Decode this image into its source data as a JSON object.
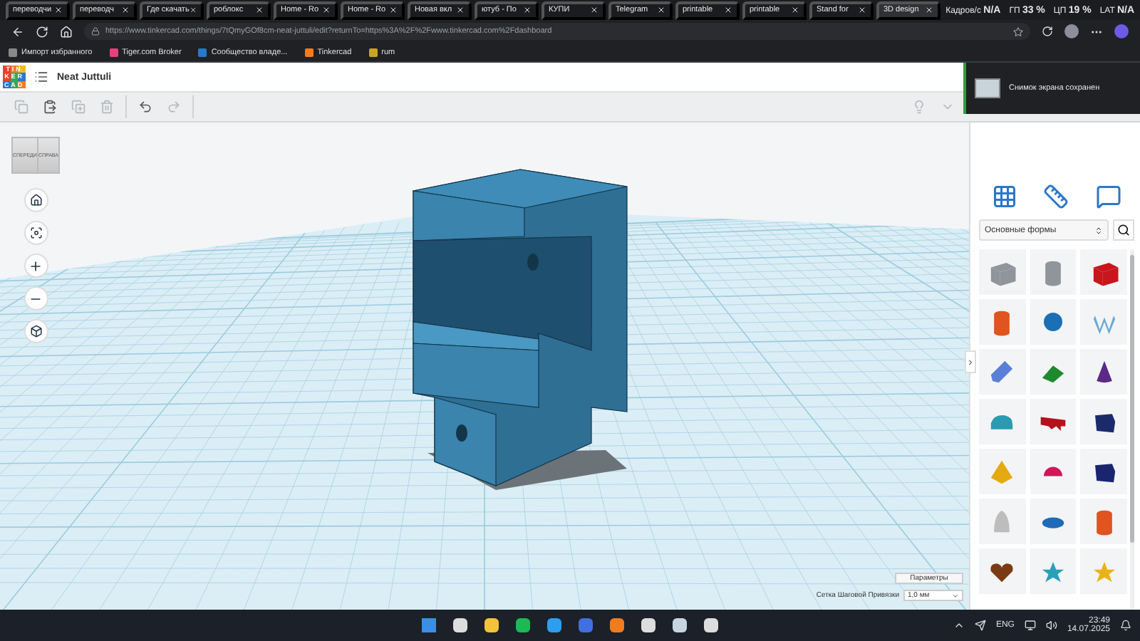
{
  "browser": {
    "tabs": [
      {
        "title": "переводчи",
        "selected": false
      },
      {
        "title": "переводч",
        "selected": false
      },
      {
        "title": "Где скачать",
        "selected": false
      },
      {
        "title": "роблокс",
        "selected": false
      },
      {
        "title": "Home - Ro",
        "selected": false
      },
      {
        "title": "Home - Ro",
        "selected": false
      },
      {
        "title": "Новая вкл",
        "selected": false
      },
      {
        "title": "ютуб - По",
        "selected": false
      },
      {
        "title": "КУПИ",
        "selected": false
      },
      {
        "title": "Telegram",
        "selected": false
      },
      {
        "title": "printable",
        "selected": false
      },
      {
        "title": "printable",
        "selected": false
      },
      {
        "title": "Stand for",
        "selected": false
      },
      {
        "title": "3D design",
        "selected": true
      }
    ],
    "url": "https://www.tinkercad.com/things/7tQmyGOf8cm-neat-juttuli/edit?returnTo=https%3A%2F%2Fwww.tinkercad.com%2Fdashboard",
    "bookmarks": [
      "Импорт избранного",
      "Tiger.com Broker",
      "Сообщество владе...",
      "Tinkercad",
      "rum"
    ]
  },
  "stats": [
    {
      "label": "Кадров/с",
      "value": "N/A"
    },
    {
      "label": "ГП",
      "value": "33 %"
    },
    {
      "label": "ЦП",
      "value": "19 %"
    },
    {
      "label": "LAT",
      "value": "N/A"
    }
  ],
  "app": {
    "logo": [
      "TIN",
      "KER",
      "CAD"
    ],
    "title": "Neat Juttuli"
  },
  "toast": "Снимок экрана сохранен",
  "viewcube": [
    "СПЕРЕДИ",
    "СПРАВА"
  ],
  "panel": {
    "category": "Основные формы",
    "shapes": [
      {
        "kind": "box_hole",
        "color": "#8f959b"
      },
      {
        "kind": "cylinder_hole",
        "color": "#8f959b"
      },
      {
        "kind": "box",
        "color": "#c8161d"
      },
      {
        "kind": "cylinder",
        "color": "#e0541f"
      },
      {
        "kind": "sphere",
        "color": "#1a6fb5"
      },
      {
        "kind": "scribble",
        "color": "#6aa8d8"
      },
      {
        "kind": "sketch",
        "color": "#5a7fd6"
      },
      {
        "kind": "roof",
        "color": "#1e8a2e"
      },
      {
        "kind": "cone",
        "color": "#5b2a86"
      },
      {
        "kind": "round_roof",
        "color": "#2a9bb0"
      },
      {
        "kind": "text",
        "color": "#b3121c"
      },
      {
        "kind": "wedge",
        "color": "#1b2a6b"
      },
      {
        "kind": "pyramid",
        "color": "#e5a912"
      },
      {
        "kind": "half_sphere",
        "color": "#d01656"
      },
      {
        "kind": "polygon",
        "color": "#1a2570"
      },
      {
        "kind": "paraboloid",
        "color": "#bdbdbd"
      },
      {
        "kind": "torus",
        "color": "#1f6bb8"
      },
      {
        "kind": "tube",
        "color": "#e0541f"
      },
      {
        "kind": "heart",
        "color": "#7a3b12"
      },
      {
        "kind": "star",
        "color": "#2aa0b8"
      },
      {
        "kind": "star",
        "color": "#e8b316"
      }
    ]
  },
  "footer": {
    "settings_button": "Параметры",
    "snap_label": "Сетка Шаговой Привязки",
    "snap_value": "1,0 мм"
  },
  "taskbar": {
    "language": "ENG",
    "time": "23:49",
    "date": "14.07.2025"
  }
}
